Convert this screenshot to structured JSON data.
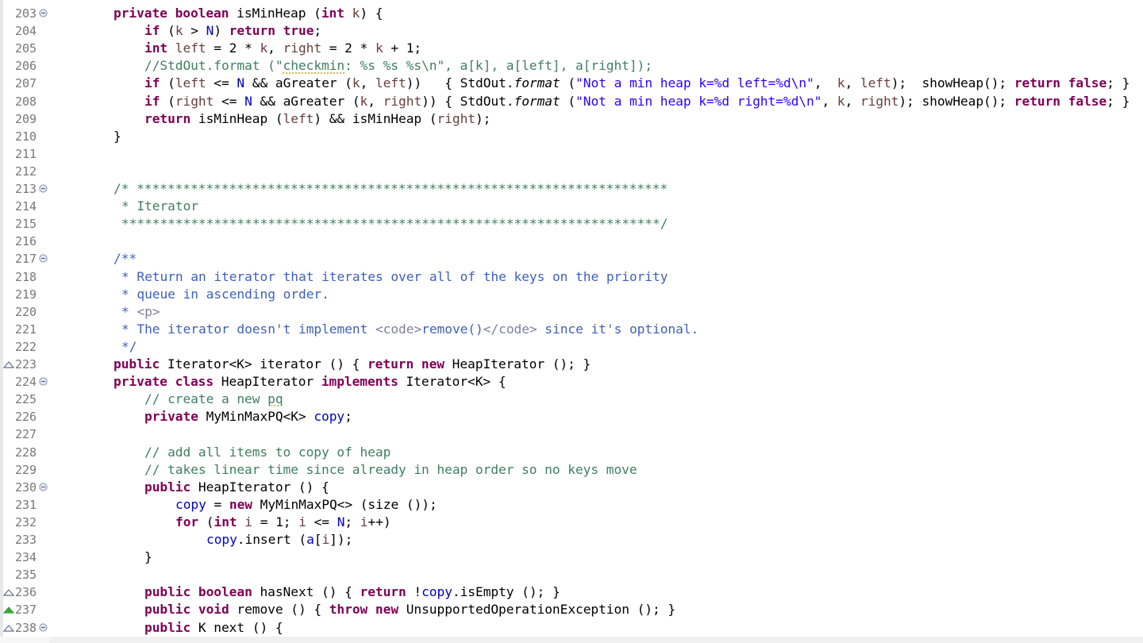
{
  "editor": {
    "language": "java",
    "colors": {
      "keyword": "#7f0055",
      "field": "#0000c0",
      "local_variable": "#6a3e3e",
      "string": "#2a00ff",
      "comment": "#3f7f5f",
      "javadoc": "#3f5fbf",
      "javadoc_tag": "#7f7f9f",
      "line_number": "#787878",
      "override_marker": "#6a6a8a",
      "implements_marker": "#3fa33f"
    },
    "lines": [
      {
        "n": "203",
        "fold": true,
        "indent": 0,
        "tokens": [
          [
            "kw",
            "private"
          ],
          [
            "p",
            " "
          ],
          [
            "kw",
            "boolean"
          ],
          [
            "p",
            " isMinHeap ("
          ],
          [
            "kw",
            "int"
          ],
          [
            "p",
            " "
          ],
          [
            "var",
            "k"
          ],
          [
            "p",
            ") {"
          ]
        ]
      },
      {
        "n": "204",
        "indent": 1,
        "tokens": [
          [
            "kw",
            "if"
          ],
          [
            "p",
            " ("
          ],
          [
            "var",
            "k"
          ],
          [
            "p",
            " > "
          ],
          [
            "fld",
            "N"
          ],
          [
            "p",
            ") "
          ],
          [
            "kw",
            "return"
          ],
          [
            "p",
            " "
          ],
          [
            "kw",
            "true"
          ],
          [
            "p",
            ";"
          ]
        ]
      },
      {
        "n": "205",
        "indent": 1,
        "tokens": [
          [
            "kw",
            "int"
          ],
          [
            "p",
            " "
          ],
          [
            "var",
            "left"
          ],
          [
            "p",
            " = 2 * "
          ],
          [
            "var",
            "k"
          ],
          [
            "p",
            ", "
          ],
          [
            "var",
            "right"
          ],
          [
            "p",
            " = 2 * "
          ],
          [
            "var",
            "k"
          ],
          [
            "p",
            " + 1;"
          ]
        ]
      },
      {
        "n": "206",
        "indent": 1,
        "tokens": [
          [
            "cmt",
            "//StdOut.format (\""
          ],
          [
            "cmt-sq",
            "checkmin"
          ],
          [
            "cmt",
            ": %s %s %s\\n\", a[k], a[left], a[right]);"
          ]
        ]
      },
      {
        "n": "207",
        "indent": 1,
        "tokens": [
          [
            "kw",
            "if"
          ],
          [
            "p",
            " ("
          ],
          [
            "var",
            "left"
          ],
          [
            "p",
            " <= "
          ],
          [
            "fld",
            "N"
          ],
          [
            "p",
            " && aGreater ("
          ],
          [
            "var",
            "k"
          ],
          [
            "p",
            ", "
          ],
          [
            "var",
            "left"
          ],
          [
            "p",
            "))   { StdOut."
          ],
          [
            "it",
            "format"
          ],
          [
            "p",
            " ("
          ],
          [
            "str",
            "\"Not a min heap k=%d left=%d\\n\""
          ],
          [
            "p",
            ",  "
          ],
          [
            "var",
            "k"
          ],
          [
            "p",
            ", "
          ],
          [
            "var",
            "left"
          ],
          [
            "p",
            ");  showHeap(); "
          ],
          [
            "kw",
            "return"
          ],
          [
            "p",
            " "
          ],
          [
            "kw",
            "false"
          ],
          [
            "p",
            "; }"
          ]
        ]
      },
      {
        "n": "208",
        "indent": 1,
        "tokens": [
          [
            "kw",
            "if"
          ],
          [
            "p",
            " ("
          ],
          [
            "var",
            "right"
          ],
          [
            "p",
            " <= "
          ],
          [
            "fld",
            "N"
          ],
          [
            "p",
            " && aGreater ("
          ],
          [
            "var",
            "k"
          ],
          [
            "p",
            ", "
          ],
          [
            "var",
            "right"
          ],
          [
            "p",
            ")) { StdOut."
          ],
          [
            "it",
            "format"
          ],
          [
            "p",
            " ("
          ],
          [
            "str",
            "\"Not a min heap k=%d right=%d\\n\""
          ],
          [
            "p",
            ", "
          ],
          [
            "var",
            "k"
          ],
          [
            "p",
            ", "
          ],
          [
            "var",
            "right"
          ],
          [
            "p",
            "); showHeap(); "
          ],
          [
            "kw",
            "return"
          ],
          [
            "p",
            " "
          ],
          [
            "kw",
            "false"
          ],
          [
            "p",
            "; }"
          ]
        ]
      },
      {
        "n": "209",
        "indent": 1,
        "tokens": [
          [
            "kw",
            "return"
          ],
          [
            "p",
            " isMinHeap ("
          ],
          [
            "var",
            "left"
          ],
          [
            "p",
            ") && isMinHeap ("
          ],
          [
            "var",
            "right"
          ],
          [
            "p",
            ");"
          ]
        ]
      },
      {
        "n": "210",
        "indent": 0,
        "tokens": [
          [
            "p",
            "}"
          ]
        ]
      },
      {
        "n": "211",
        "indent": 0,
        "tokens": []
      },
      {
        "n": "212",
        "indent": 0,
        "tokens": []
      },
      {
        "n": "213",
        "fold": true,
        "indent": 0,
        "tokens": [
          [
            "cmt",
            "/* *********************************************************************"
          ]
        ]
      },
      {
        "n": "214",
        "indent": "c1",
        "tokens": [
          [
            "cmt",
            "* Iterator"
          ]
        ]
      },
      {
        "n": "215",
        "indent": "c1",
        "tokens": [
          [
            "cmt",
            "**********************************************************************/"
          ]
        ]
      },
      {
        "n": "216",
        "indent": 0,
        "tokens": []
      },
      {
        "n": "217",
        "fold": true,
        "indent": 0,
        "tokens": [
          [
            "jd",
            "/**"
          ]
        ]
      },
      {
        "n": "218",
        "indent": "c1",
        "tokens": [
          [
            "jd",
            "* Return an iterator that iterates over all of the keys on the priority"
          ]
        ]
      },
      {
        "n": "219",
        "indent": "c1",
        "tokens": [
          [
            "jd",
            "* queue in ascending order."
          ]
        ]
      },
      {
        "n": "220",
        "indent": "c1",
        "tokens": [
          [
            "jd",
            "* "
          ],
          [
            "jdtag",
            "<p>"
          ]
        ]
      },
      {
        "n": "221",
        "indent": "c1",
        "tokens": [
          [
            "jd",
            "* The iterator doesn't implement "
          ],
          [
            "jdtag",
            "<code>"
          ],
          [
            "jd",
            "remove()"
          ],
          [
            "jdtag",
            "</code>"
          ],
          [
            "jd",
            " since it's optional."
          ]
        ]
      },
      {
        "n": "222",
        "indent": "c1",
        "tokens": [
          [
            "jd",
            "*/"
          ]
        ]
      },
      {
        "n": "223",
        "marker": "override",
        "indent": 0,
        "tokens": [
          [
            "kw",
            "public"
          ],
          [
            "p",
            " Iterator<K> iterator () { "
          ],
          [
            "kw",
            "return"
          ],
          [
            "p",
            " "
          ],
          [
            "kw",
            "new"
          ],
          [
            "p",
            " HeapIterator (); }"
          ]
        ]
      },
      {
        "n": "224",
        "fold": true,
        "indent": 0,
        "tokens": [
          [
            "kw",
            "private"
          ],
          [
            "p",
            " "
          ],
          [
            "kw",
            "class"
          ],
          [
            "p",
            " HeapIterator "
          ],
          [
            "kw",
            "implements"
          ],
          [
            "p",
            " Iterator<K> {"
          ]
        ]
      },
      {
        "n": "225",
        "indent": 1,
        "tokens": [
          [
            "cmt",
            "// create a new "
          ],
          [
            "cmt-sq",
            "pq"
          ]
        ]
      },
      {
        "n": "226",
        "indent": 1,
        "tokens": [
          [
            "kw",
            "private"
          ],
          [
            "p",
            " MyMinMaxPQ<K> "
          ],
          [
            "fld",
            "copy"
          ],
          [
            "p",
            ";"
          ]
        ]
      },
      {
        "n": "227",
        "indent": 0,
        "tokens": []
      },
      {
        "n": "228",
        "indent": 1,
        "tokens": [
          [
            "cmt",
            "// add all items to copy of heap"
          ]
        ]
      },
      {
        "n": "229",
        "indent": 1,
        "tokens": [
          [
            "cmt",
            "// takes linear time since already in heap order so no keys move"
          ]
        ]
      },
      {
        "n": "230",
        "fold": true,
        "indent": 1,
        "tokens": [
          [
            "kw",
            "public"
          ],
          [
            "p",
            " HeapIterator () {"
          ]
        ]
      },
      {
        "n": "231",
        "indent": 2,
        "tokens": [
          [
            "fld",
            "copy"
          ],
          [
            "p",
            " = "
          ],
          [
            "kw",
            "new"
          ],
          [
            "p",
            " MyMinMaxPQ<> (size ());"
          ]
        ]
      },
      {
        "n": "232",
        "indent": 2,
        "tokens": [
          [
            "kw",
            "for"
          ],
          [
            "p",
            " ("
          ],
          [
            "kw",
            "int"
          ],
          [
            "p",
            " "
          ],
          [
            "var",
            "i"
          ],
          [
            "p",
            " = 1; "
          ],
          [
            "var",
            "i"
          ],
          [
            "p",
            " <= "
          ],
          [
            "fld",
            "N"
          ],
          [
            "p",
            "; "
          ],
          [
            "var",
            "i"
          ],
          [
            "p",
            "++)"
          ]
        ]
      },
      {
        "n": "233",
        "indent": 3,
        "tokens": [
          [
            "fld",
            "copy"
          ],
          [
            "p",
            ".insert ("
          ],
          [
            "fld",
            "a"
          ],
          [
            "p",
            "["
          ],
          [
            "var",
            "i"
          ],
          [
            "p",
            "]);"
          ]
        ]
      },
      {
        "n": "234",
        "indent": 1,
        "tokens": [
          [
            "p",
            "}"
          ]
        ]
      },
      {
        "n": "235",
        "indent": 0,
        "tokens": []
      },
      {
        "n": "236",
        "marker": "override",
        "indent": 1,
        "tokens": [
          [
            "kw",
            "public"
          ],
          [
            "p",
            " "
          ],
          [
            "kw",
            "boolean"
          ],
          [
            "p",
            " hasNext () { "
          ],
          [
            "kw",
            "return"
          ],
          [
            "p",
            " !"
          ],
          [
            "fld",
            "copy"
          ],
          [
            "p",
            ".isEmpty (); }"
          ]
        ]
      },
      {
        "n": "237",
        "marker": "implements",
        "indent": 1,
        "tokens": [
          [
            "kw",
            "public"
          ],
          [
            "p",
            " "
          ],
          [
            "kw",
            "void"
          ],
          [
            "p",
            " remove () { "
          ],
          [
            "kw",
            "throw"
          ],
          [
            "p",
            " "
          ],
          [
            "kw",
            "new"
          ],
          [
            "p",
            " UnsupportedOperationException (); }"
          ]
        ]
      },
      {
        "n": "238",
        "marker": "override",
        "fold": true,
        "indent": 1,
        "tokens": [
          [
            "kw",
            "public"
          ],
          [
            "p",
            " K next () {"
          ]
        ]
      }
    ]
  }
}
